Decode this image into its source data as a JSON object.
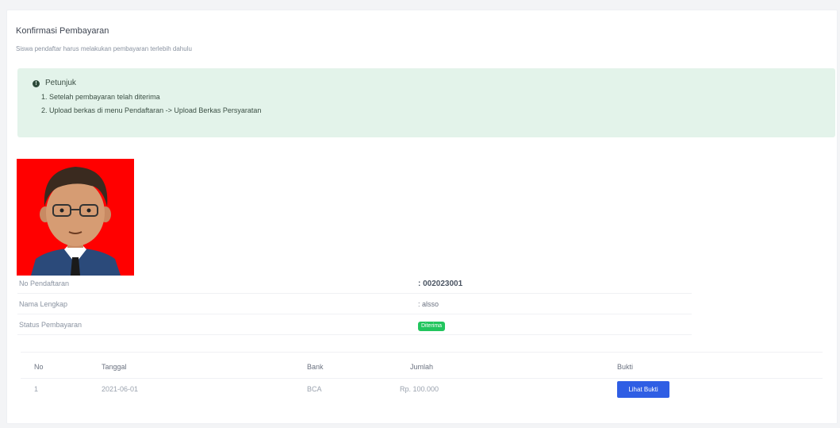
{
  "page": {
    "title": "Konfirmasi Pembayaran",
    "subtitle": "Siswa pendaftar harus melakukan pembayaran terlebih dahulu"
  },
  "alert": {
    "icon": "info-icon",
    "heading": "Petunjuk",
    "items": [
      "1. Setelah pembayaran telah diterima",
      "2. Upload berkas di menu Pendaftaran -> Upload Berkas Persyaratan"
    ],
    "background": "#e3f3ea"
  },
  "profile": {
    "photo_background": "#ff0000",
    "rows": [
      {
        "label": "No Pendaftaran",
        "value": ": 002023001"
      },
      {
        "label": "Nama Lengkap",
        "value": ": alsso"
      },
      {
        "label": "Status Pembayaran",
        "badge": "Diterima"
      }
    ]
  },
  "payments": {
    "columns": [
      "No",
      "Tanggal",
      "Bank",
      "Jumlah",
      "Bukti"
    ],
    "rows": [
      {
        "no": "1",
        "tanggal": "2021-06-01",
        "bank": "BCA",
        "jumlah": "Rp. 100.000",
        "bukti_label": "Lihat Bukti"
      }
    ]
  },
  "colors": {
    "primary_button": "#2f5ee4",
    "success_badge": "#22c55e"
  }
}
